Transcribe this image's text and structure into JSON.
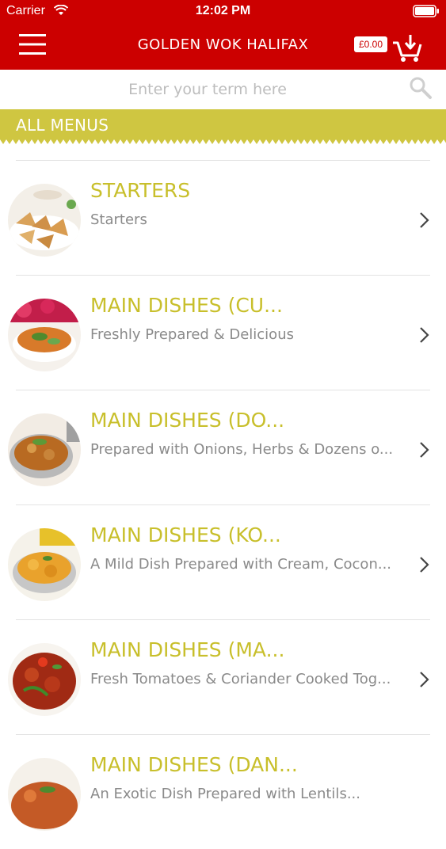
{
  "status_bar": {
    "carrier": "Carrier",
    "time": "12:02 PM"
  },
  "header": {
    "title": "GOLDEN WOK HALIFAX",
    "cart_total": "£0.00",
    "brand_color": "#cc0000"
  },
  "search": {
    "placeholder": "Enter your term here"
  },
  "section": {
    "label": "ALL MENUS",
    "accent_color": "#cfc641"
  },
  "menu_items": [
    {
      "title": "STARTERS",
      "subtitle": "Starters"
    },
    {
      "title": "MAIN DISHES (CU...",
      "subtitle": "Freshly Prepared & Delicious"
    },
    {
      "title": "MAIN DISHES (DO...",
      "subtitle": "Prepared with Onions, Herbs & Dozens o..."
    },
    {
      "title": "MAIN DISHES (KO...",
      "subtitle": "A Mild Dish Prepared with Cream, Cocon..."
    },
    {
      "title": "MAIN DISHES (MA...",
      "subtitle": "Fresh Tomatoes & Coriander Cooked Tog..."
    },
    {
      "title": "MAIN DISHES (DAN...",
      "subtitle": "An Exotic Dish Prepared with Lentils..."
    }
  ],
  "icons": [
    "menu-icon",
    "wifi-icon",
    "battery-icon",
    "cart-icon",
    "search-icon",
    "chevron-right-icon"
  ]
}
